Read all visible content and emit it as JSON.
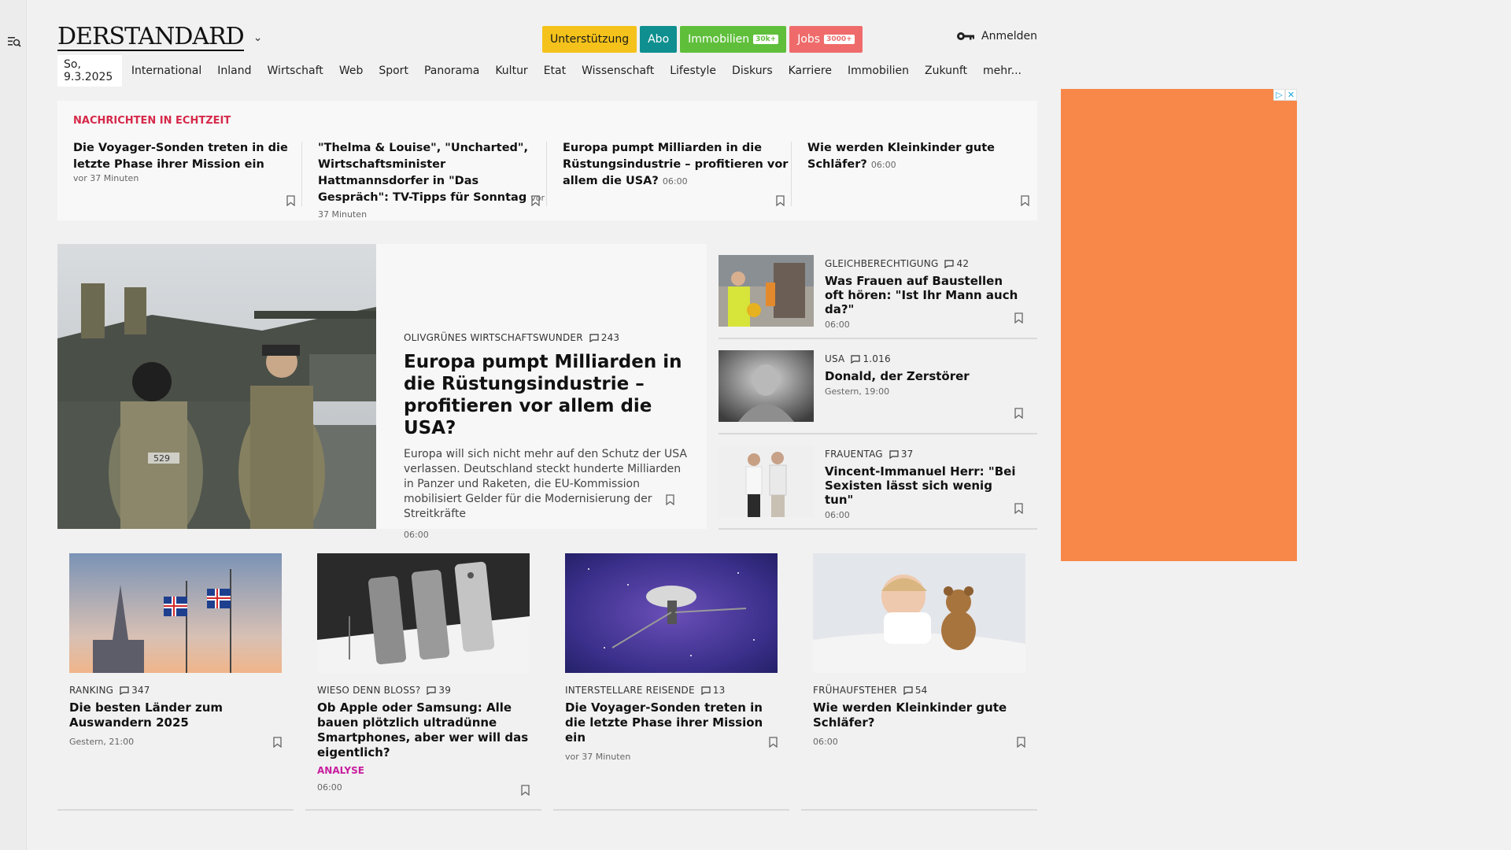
{
  "header": {
    "logo": "DERSTANDARD",
    "buttons": {
      "support": "Unterstützung",
      "abo": "Abo",
      "immobilien": "Immobilien",
      "immobilien_badge": "30k+",
      "jobs": "Jobs",
      "jobs_badge": "3000+"
    },
    "login": "Anmelden"
  },
  "nav": {
    "date": "So, 9.3.2025",
    "items": [
      "International",
      "Inland",
      "Wirtschaft",
      "Web",
      "Sport",
      "Panorama",
      "Kultur",
      "Etat",
      "Wissenschaft",
      "Lifestyle",
      "Diskurs",
      "Karriere",
      "Immobilien",
      "Zukunft",
      "mehr..."
    ]
  },
  "realtime": {
    "title": "NACHRICHTEN IN ECHTZEIT",
    "items": [
      {
        "headline": "Die Voyager-Sonden treten in die letzte Phase ihrer Mission ein",
        "time": "vor 37 Minuten"
      },
      {
        "headline": "\"Thelma & Louise\", \"Uncharted\", Wirtschaftsminister Hattmannsdorfer in \"Das Gespräch\": TV-Tipps für Sonntag",
        "time": "vor 37 Minuten"
      },
      {
        "headline": "Europa pumpt Milliarden in die Rüstungsindustrie – profitieren vor allem die USA?",
        "time": "06:00"
      },
      {
        "headline": "Wie werden Kleinkinder gute Schläfer?",
        "time": "06:00"
      }
    ]
  },
  "lead": {
    "kicker": "OLIVGRÜNES WIRTSCHAFTSWUNDER",
    "comments": "243",
    "title": "Europa pumpt Milliarden in die Rüstungsindustrie – profitieren vor allem die USA?",
    "teaser": "Europa will sich nicht mehr auf den Schutz der USA verlassen. Deutschland steckt hunderte Milliarden in Panzer und Raketen, die EU-Kommission mobilisiert Gelder für die Modernisierung der Streitkräfte",
    "time": "06:00",
    "image_text": "529"
  },
  "side": [
    {
      "kicker": "GLEICHBERECHTIGUNG",
      "comments": "42",
      "title": "Was Frauen auf Baustellen oft hören: \"Ist Ihr Mann auch da?\"",
      "time": "06:00"
    },
    {
      "kicker": "USA",
      "comments": "1.016",
      "title": "Donald, der Zerstörer",
      "time": "Gestern, 19:00"
    },
    {
      "kicker": "FRAUENTAG",
      "comments": "37",
      "title": "Vincent-Immanuel Herr: \"Bei Sexisten lässt sich wenig tun\"",
      "time": "06:00"
    }
  ],
  "cards": [
    {
      "kicker": "RANKING",
      "comments": "347",
      "title": "Die besten Länder zum Auswandern 2025",
      "time": "Gestern, 21:00"
    },
    {
      "kicker": "WIESO DENN BLOSS?",
      "comments": "39",
      "title": "Ob Apple oder Samsung: Alle bauen plötzlich ultradünne Smartphones, aber wer will das eigentlich?",
      "tag": "ANALYSE",
      "time": "06:00"
    },
    {
      "kicker": "INTERSTELLARE REISENDE",
      "comments": "13",
      "title": "Die Voyager-Sonden treten in die letzte Phase ihrer Mission ein",
      "time": "vor 37 Minuten"
    },
    {
      "kicker": "FRÜHAUFSTEHER",
      "comments": "54",
      "title": "Wie werden Kleinkinder gute Schläfer?",
      "time": "06:00"
    }
  ],
  "colors": {
    "realtime_title": "#d6294a",
    "support": "#f4c21a",
    "abo": "#0f8f8f",
    "immobilien": "#5fbf3b",
    "jobs": "#ef6b6b",
    "ad_background": "#f7884a",
    "analyse_tag": "#c81e9e"
  },
  "icons": {
    "menu": "menu-search-icon",
    "logo_toggle": "chevron-down-icon",
    "login": "key-icon",
    "comments": "comment-icon",
    "bookmark": "bookmark-icon",
    "ad": "adchoices-icon",
    "ad_close": "close-icon"
  }
}
